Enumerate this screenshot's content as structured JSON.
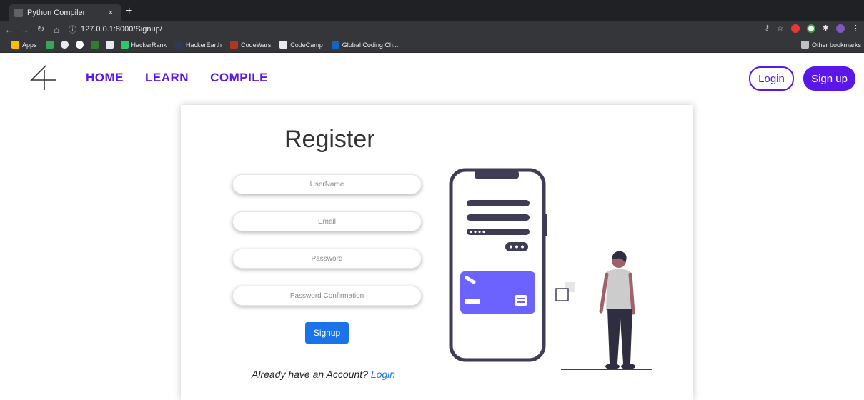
{
  "browser": {
    "tab_title": "Python Compiler",
    "tab_close": "×",
    "new_tab": "+",
    "url": "127.0.0.1:8000/Signup/",
    "bookmarks": [
      "Apps",
      "HackerRank",
      "HackerEarth",
      "CodeWars",
      "CodeCamp",
      "Global Coding Ch..."
    ],
    "other_bookmarks": "Other bookmarks"
  },
  "site": {
    "nav": [
      "HOME",
      "LEARN",
      "COMPILE"
    ],
    "login": "Login",
    "signup": "Sign up"
  },
  "form": {
    "title": "Register",
    "fields": {
      "username": "UserName",
      "email": "Email",
      "password": "Password",
      "confirm": "Password Confirmation"
    },
    "submit": "Signup",
    "account_text": "Already have an Account?",
    "account_link": "Login"
  },
  "colors": {
    "brand": "#5a17e8",
    "primary_button": "#1a73e8",
    "illustration_card": "#6c63ff",
    "phone_outline": "#3f3d56"
  }
}
